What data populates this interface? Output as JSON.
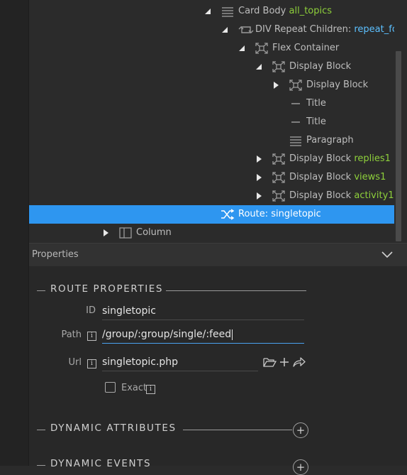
{
  "tree": {
    "rows": [
      {
        "label": "Card Body",
        "tag": "all_topics"
      },
      {
        "label": "DIV Repeat Children:",
        "tag": "repeat_forum"
      },
      {
        "label": "Flex Container",
        "tag": ""
      },
      {
        "label": "Display Block",
        "tag": ""
      },
      {
        "label": "Display Block",
        "tag": ""
      },
      {
        "label": "Title",
        "tag": ""
      },
      {
        "label": "Title",
        "tag": ""
      },
      {
        "label": "Paragraph",
        "tag": ""
      },
      {
        "label": "Display Block",
        "tag": "replies1"
      },
      {
        "label": "Display Block",
        "tag": "views1"
      },
      {
        "label": "Display Block",
        "tag": "activity1"
      },
      {
        "label": "Route: singletopic",
        "tag": ""
      },
      {
        "label": "Column",
        "tag": ""
      }
    ]
  },
  "properties": {
    "title": "Properties",
    "route_section": "ROUTE PROPERTIES",
    "id_label": "ID",
    "id_value": "singletopic",
    "path_label": "Path",
    "path_value": "/group/:group/single/:feed",
    "url_label": "Url",
    "url_value": "singletopic.php",
    "exact_label": "Exact",
    "info_glyph": "i",
    "dynamic_attributes": "DYNAMIC ATTRIBUTES",
    "dynamic_events": "DYNAMIC EVENTS",
    "plus_glyph": "+"
  },
  "colors": {
    "selected": "#2e96f0",
    "highlight_green": "#8ed03b",
    "highlight_blue": "#5cc0ff",
    "background": "#2b2b2b"
  },
  "icons": [
    "list-icon",
    "repeat-icon",
    "flex-icon",
    "block-icon",
    "dash-icon",
    "paragraph-icon",
    "route-icon",
    "column-icon",
    "folder-icon",
    "plus-icon",
    "share-icon",
    "chevron-down-icon",
    "info-icon"
  ]
}
